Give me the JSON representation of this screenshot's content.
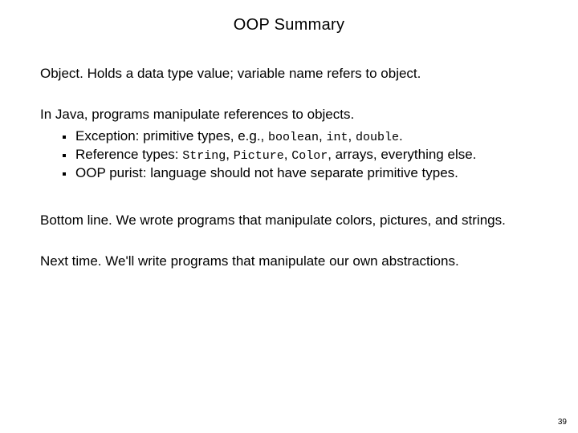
{
  "title": "OOP Summary",
  "p1": {
    "lead": "Object.",
    "rest": "  Holds a data type value; variable name refers to object."
  },
  "p2": "In Java, programs manipulate references to objects.",
  "bullets": [
    {
      "pre": "Exception:  primitive types, e.g., ",
      "codes": [
        "boolean",
        "int",
        "double"
      ],
      "post": "."
    },
    {
      "pre": "Reference types:  ",
      "codes": [
        "String",
        "Picture",
        "Color"
      ],
      "post": ", arrays, everything else."
    },
    {
      "pre": "OOP purist:  language should not have separate primitive types.",
      "codes": [],
      "post": ""
    }
  ],
  "p3": {
    "lead": "Bottom line.",
    "rest": "  We wrote programs that manipulate colors, pictures, and strings."
  },
  "p4": {
    "lead": "Next time.",
    "rest": "  We'll write programs that manipulate our own abstractions."
  },
  "sep": ", ",
  "pagenum": "39"
}
